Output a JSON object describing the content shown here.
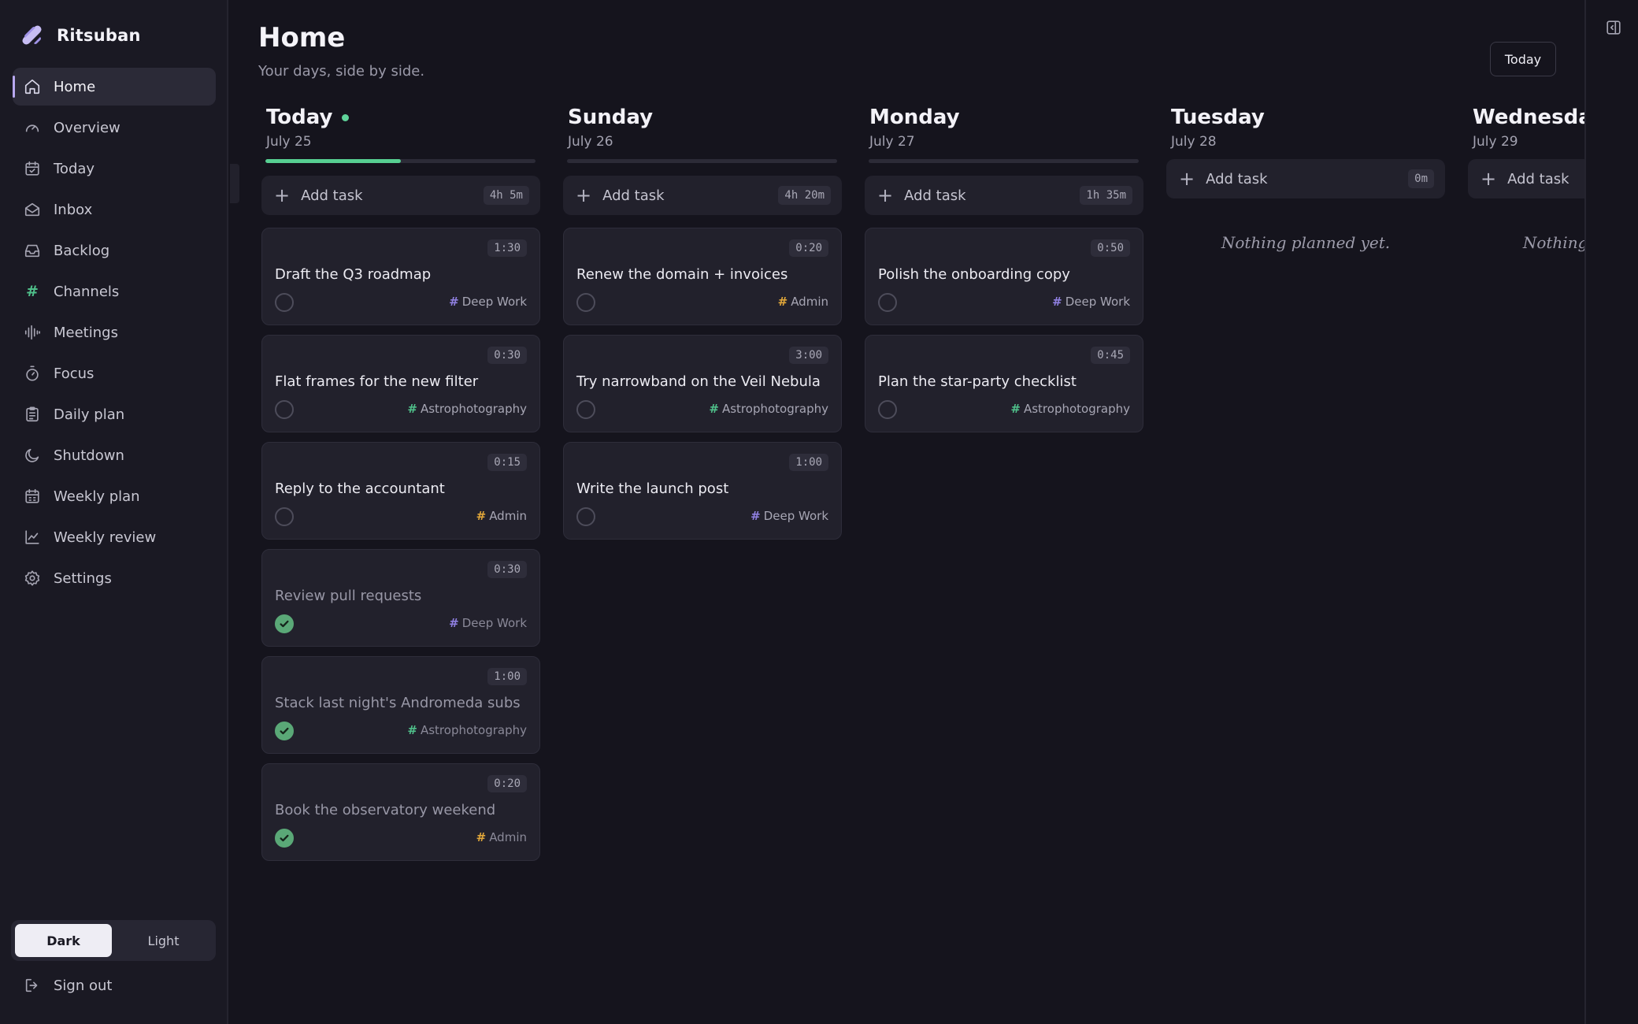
{
  "app": {
    "name": "Ritsuban"
  },
  "sidebar": {
    "items": [
      {
        "id": "home",
        "label": "Home",
        "icon": "home-icon",
        "active": true
      },
      {
        "id": "overview",
        "label": "Overview",
        "icon": "gauge-icon"
      },
      {
        "id": "today",
        "label": "Today",
        "icon": "calendar-check-icon"
      },
      {
        "id": "inbox",
        "label": "Inbox",
        "icon": "inbox-open-icon"
      },
      {
        "id": "backlog",
        "label": "Backlog",
        "icon": "tray-icon"
      },
      {
        "id": "channels",
        "label": "Channels",
        "icon": "hash-icon"
      },
      {
        "id": "meetings",
        "label": "Meetings",
        "icon": "audio-wave-icon"
      },
      {
        "id": "focus",
        "label": "Focus",
        "icon": "stopwatch-icon"
      },
      {
        "id": "daily-plan",
        "label": "Daily plan",
        "icon": "clipboard-icon"
      },
      {
        "id": "shutdown",
        "label": "Shutdown",
        "icon": "moon-icon"
      },
      {
        "id": "weekly-plan",
        "label": "Weekly plan",
        "icon": "calendar-grid-icon"
      },
      {
        "id": "weekly-review",
        "label": "Weekly review",
        "icon": "line-chart-icon"
      },
      {
        "id": "settings",
        "label": "Settings",
        "icon": "gear-icon"
      }
    ],
    "theme": {
      "dark": "Dark",
      "light": "Light",
      "selected": "Dark"
    },
    "sign_out": "Sign out"
  },
  "header": {
    "title": "Home",
    "subtitle": "Your days, side by side.",
    "today_button": "Today"
  },
  "add_task_label": "Add task",
  "empty_label": "Nothing planned yet.",
  "colors": {
    "deep_work": "#8f7fe0",
    "astrophotography": "#4fbf8a",
    "admin": "#e0a63a",
    "progress": "#57cf92"
  },
  "columns": [
    {
      "day": "Today",
      "date": "July 25",
      "is_today": true,
      "progress": 0.5,
      "total": "4h 5m",
      "tasks": [
        {
          "title": "Draft the Q3 roadmap",
          "time": "1:30",
          "tag": "Deep Work",
          "tag_key": "deep_work",
          "done": false
        },
        {
          "title": "Flat frames for the new filter",
          "time": "0:30",
          "tag": "Astrophotography",
          "tag_key": "astrophotography",
          "done": false
        },
        {
          "title": "Reply to the accountant",
          "time": "0:15",
          "tag": "Admin",
          "tag_key": "admin",
          "done": false
        },
        {
          "title": "Review pull requests",
          "time": "0:30",
          "tag": "Deep Work",
          "tag_key": "deep_work",
          "done": true
        },
        {
          "title": "Stack last night's Andromeda subs",
          "time": "1:00",
          "tag": "Astrophotography",
          "tag_key": "astrophotography",
          "done": true
        },
        {
          "title": "Book the observatory weekend",
          "time": "0:20",
          "tag": "Admin",
          "tag_key": "admin",
          "done": true
        }
      ]
    },
    {
      "day": "Sunday",
      "date": "July 26",
      "is_today": false,
      "progress": 0,
      "total": "4h 20m",
      "tasks": [
        {
          "title": "Renew the domain + invoices",
          "time": "0:20",
          "tag": "Admin",
          "tag_key": "admin",
          "done": false
        },
        {
          "title": "Try narrowband on the Veil Nebula",
          "time": "3:00",
          "tag": "Astrophotography",
          "tag_key": "astrophotography",
          "done": false
        },
        {
          "title": "Write the launch post",
          "time": "1:00",
          "tag": "Deep Work",
          "tag_key": "deep_work",
          "done": false
        }
      ]
    },
    {
      "day": "Monday",
      "date": "July 27",
      "is_today": false,
      "progress": 0,
      "total": "1h 35m",
      "tasks": [
        {
          "title": "Polish the onboarding copy",
          "time": "0:50",
          "tag": "Deep Work",
          "tag_key": "deep_work",
          "done": false
        },
        {
          "title": "Plan the star-party checklist",
          "time": "0:45",
          "tag": "Astrophotography",
          "tag_key": "astrophotography",
          "done": false
        }
      ]
    },
    {
      "day": "Tuesday",
      "date": "July 28",
      "is_today": false,
      "progress": null,
      "total": "0m",
      "tasks": []
    },
    {
      "day": "Wednesday",
      "date": "July 29",
      "is_today": false,
      "progress": null,
      "total": "",
      "tasks": []
    }
  ]
}
